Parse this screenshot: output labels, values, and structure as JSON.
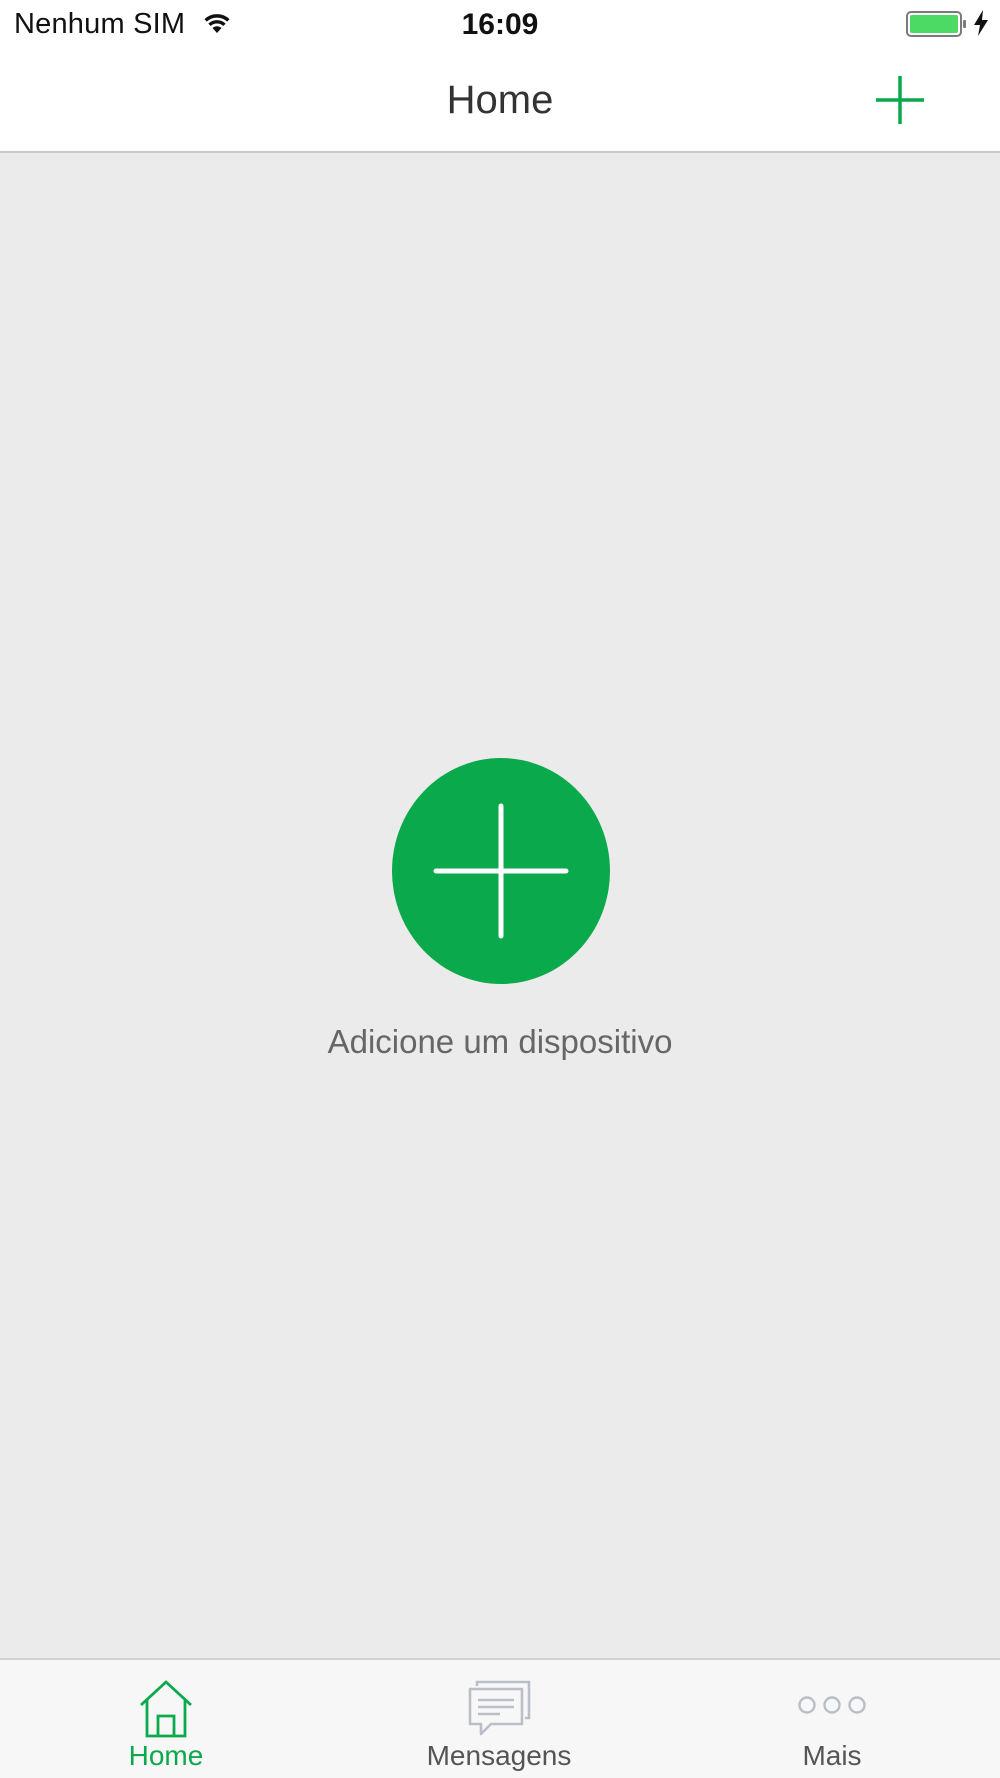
{
  "status_bar": {
    "carrier": "Nenhum SIM",
    "time": "16:09",
    "battery_color": "#4cd964"
  },
  "nav": {
    "title": "Home",
    "add_icon": "plus-icon"
  },
  "main": {
    "add_device_label": "Adicione um dispositivo",
    "add_icon": "plus-icon"
  },
  "tabs": [
    {
      "label": "Home",
      "icon": "home-icon",
      "active": true
    },
    {
      "label": "Mensagens",
      "icon": "messages-icon",
      "active": false
    },
    {
      "label": "Mais",
      "icon": "more-icon",
      "active": false
    }
  ],
  "colors": {
    "accent": "#0aa94b",
    "background": "#ebebeb",
    "tab_bar": "#f7f7f7",
    "inactive_icon": "#b8bfc6"
  }
}
